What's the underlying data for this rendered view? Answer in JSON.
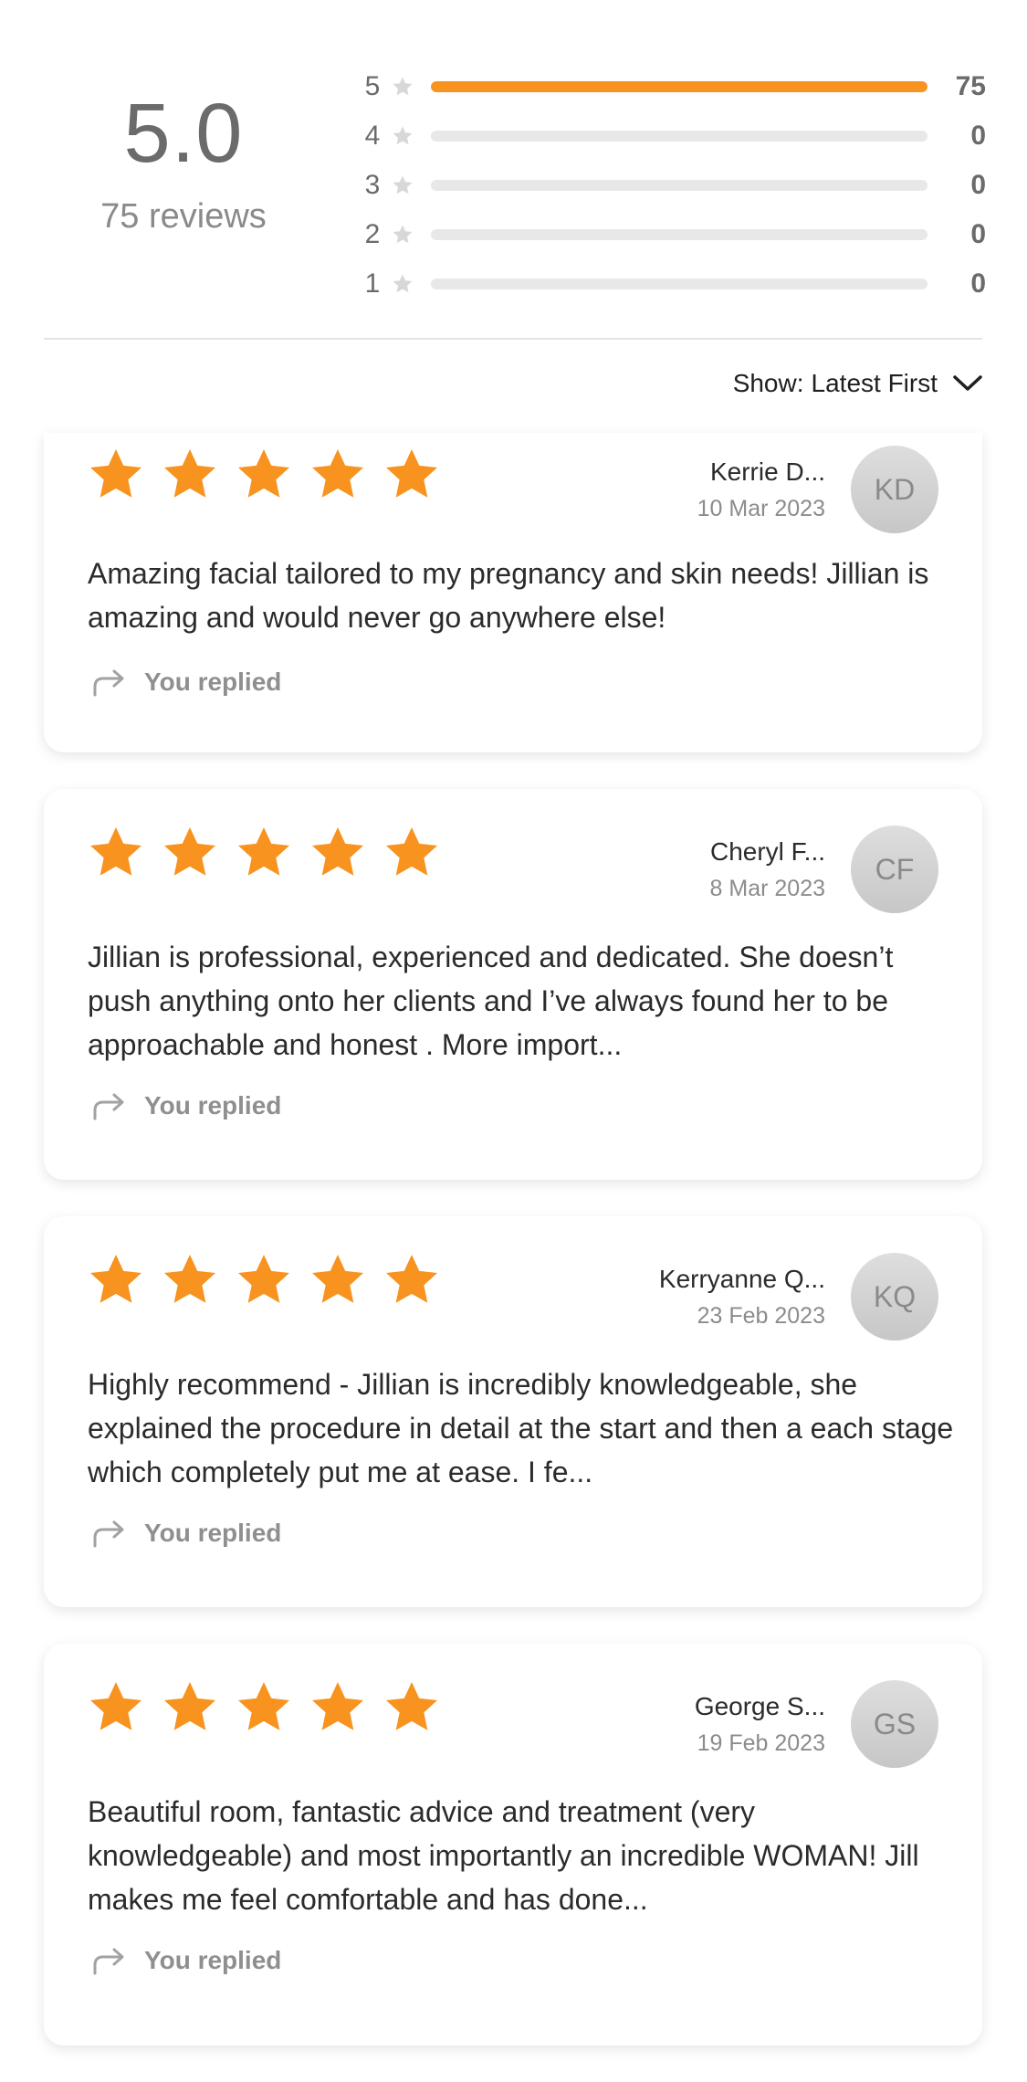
{
  "summary": {
    "score": "5.0",
    "review_count": "75 reviews",
    "histogram": [
      {
        "stars": "5",
        "count": "75",
        "fraction": 1.0
      },
      {
        "stars": "4",
        "count": "0",
        "fraction": 0
      },
      {
        "stars": "3",
        "count": "0",
        "fraction": 0
      },
      {
        "stars": "2",
        "count": "0",
        "fraction": 0
      },
      {
        "stars": "1",
        "count": "0",
        "fraction": 0
      }
    ]
  },
  "sort": {
    "prefix": "Show:",
    "value": "Latest First"
  },
  "colors": {
    "star_active": "#f7931e",
    "star_inactive": "#d8d8d8"
  },
  "reviews": [
    {
      "rating": 5,
      "name": "Kerrie D...",
      "date": "10 Mar 2023",
      "initials": "KD",
      "text": "Amazing facial tailored to my pregnancy and skin needs! Jillian is amazing and would never go anywhere else!",
      "reply": "You replied"
    },
    {
      "rating": 5,
      "name": "Cheryl F...",
      "date": "8 Mar 2023",
      "initials": "CF",
      "text": "Jillian is professional, experienced and dedicated. She doesn’t push anything onto her clients and I’ve always found her to be approachable and honest . More import...",
      "reply": "You replied"
    },
    {
      "rating": 5,
      "name": "Kerryanne Q...",
      "date": "23 Feb 2023",
      "initials": "KQ",
      "text": "Highly recommend - Jillian is incredibly knowledgeable, she explained the procedure in detail at the start and then a each stage which completely put me at ease. I fe...",
      "reply": "You replied"
    },
    {
      "rating": 5,
      "name": "George S...",
      "date": "19 Feb 2023",
      "initials": "GS",
      "text": "Beautiful room, fantastic advice and treatment (very knowledgeable) and most importantly an incredible WOMAN! Jill makes me feel comfortable and has done...",
      "reply": "You replied"
    }
  ]
}
